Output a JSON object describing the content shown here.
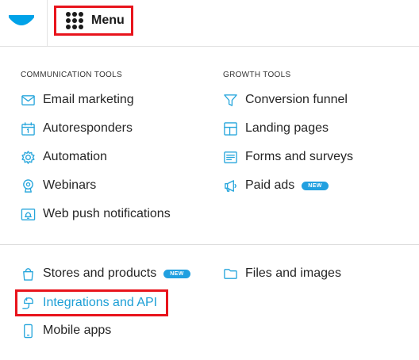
{
  "header": {
    "menu_label": "Menu"
  },
  "sections": {
    "communication_title": "COMMUNICATION TOOLS",
    "growth_title": "GROWTH TOOLS"
  },
  "communication_items": [
    {
      "label": "Email marketing",
      "icon": "envelope-icon"
    },
    {
      "label": "Autoresponders",
      "icon": "calendar-icon"
    },
    {
      "label": "Automation",
      "icon": "gear-icon"
    },
    {
      "label": "Webinars",
      "icon": "webcam-icon"
    },
    {
      "label": "Web push notifications",
      "icon": "bell-screen-icon"
    }
  ],
  "growth_items": [
    {
      "label": "Conversion funnel",
      "icon": "funnel-icon"
    },
    {
      "label": "Landing pages",
      "icon": "layout-icon"
    },
    {
      "label": "Forms and surveys",
      "icon": "form-icon"
    },
    {
      "label": "Paid ads",
      "icon": "megaphone-icon",
      "badge": "NEW"
    }
  ],
  "bottom_items": [
    {
      "label": "Stores and products",
      "icon": "shopping-bag-icon",
      "badge": "NEW"
    },
    {
      "label": "Integrations and API",
      "icon": "plug-icon"
    },
    {
      "label": "Mobile apps",
      "icon": "smartphone-icon"
    },
    {
      "label": "Files and images",
      "icon": "folder-icon"
    }
  ],
  "colors": {
    "accent": "#27a6dc",
    "highlight": "#e8141c",
    "badge": "#21a0e0",
    "brand": "#00a2e8"
  }
}
